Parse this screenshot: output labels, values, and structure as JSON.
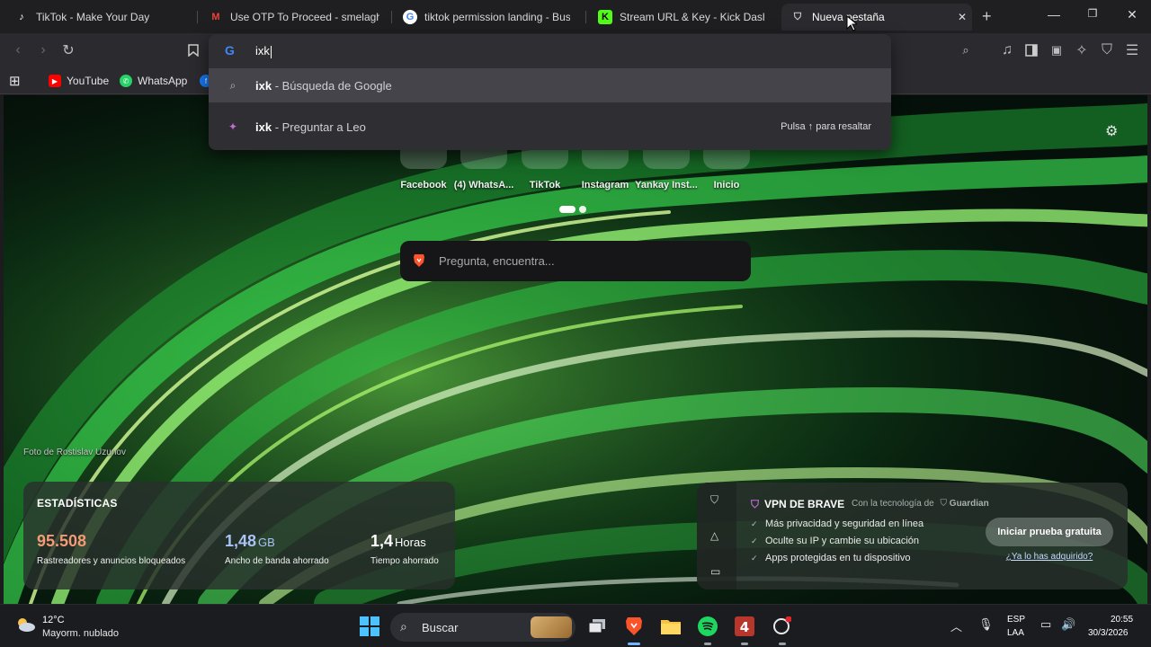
{
  "tabs": [
    {
      "title": "TikTok - Make Your Day",
      "icon": "tiktok-icon"
    },
    {
      "title": "Use OTP To Proceed - smelaghabit",
      "icon": "gmail-icon"
    },
    {
      "title": "tiktok permission landing - Buscar",
      "icon": "google-icon"
    },
    {
      "title": "Stream URL & Key - Kick Dashboa",
      "icon": "kick-icon"
    },
    {
      "title": "Nueva pestaña",
      "icon": "brave-shield-icon",
      "active": true
    }
  ],
  "address": {
    "value": "ixk"
  },
  "suggestions": [
    {
      "query": "ixk",
      "suffix": " - Búsqueda de Google"
    },
    {
      "query": "ixk",
      "suffix": " - Preguntar a Leo",
      "hint": "Pulsa ↑ para resaltar"
    }
  ],
  "bookmarks": [
    "YouTube",
    "WhatsApp"
  ],
  "top_sites": [
    "Facebook",
    "(4) WhatsA...",
    "TikTok",
    "Instagram",
    "Yankay Inst...",
    "Inicio"
  ],
  "search": {
    "placeholder": "Pregunta, encuentra..."
  },
  "photo_credit": "Foto de Rostislav Uzunov",
  "stats": {
    "title": "ESTADÍSTICAS",
    "items": [
      {
        "value": "95.508",
        "unit": "",
        "label": "Rastreadores y anuncios bloqueados",
        "color": "#f29b74"
      },
      {
        "value": "1,48",
        "unit": "GB",
        "label": "Ancho de banda ahorrado",
        "color": "#a9c3f5"
      },
      {
        "value": "1,4",
        "unit": "Horas",
        "label": "Tiempo ahorrado",
        "color": "#ffffff"
      }
    ]
  },
  "vpn": {
    "title": "VPN DE BRAVE",
    "by": "Con la tecnología de",
    "brand": "Guardian",
    "features": [
      "Más privacidad y seguridad en línea",
      "Oculte su IP y cambie su ubicación",
      "Apps protegidas en tu dispositivo"
    ],
    "cta": "Iniciar prueba gratuita",
    "link": "¿Ya lo has adquirido?"
  },
  "taskbar": {
    "temp": "12°C",
    "weather": "Mayorm. nublado",
    "search_label": "Buscar",
    "lang_top": "ESP",
    "lang_bottom": "LAA",
    "time": "20:55",
    "date": "30/3/2026"
  },
  "colors": {
    "accent_green": "#3ecb4a",
    "brave_orange": "#fb542b"
  }
}
